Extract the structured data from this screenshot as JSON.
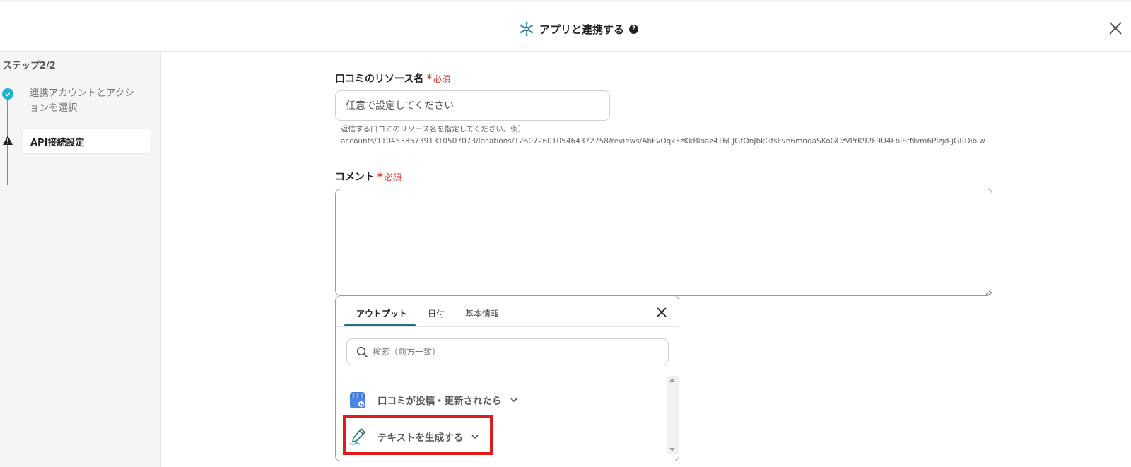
{
  "header": {
    "title": "アプリと連携する",
    "help_icon_glyph": "?",
    "app_icon": "network-hub-icon",
    "close_icon": "close-icon"
  },
  "sidebar": {
    "step_label": "ステップ2/2",
    "steps": [
      {
        "label": "連携アカウントとアクションを選択",
        "status": "completed"
      },
      {
        "label": "API接続設定",
        "status": "warning"
      }
    ],
    "accent_color": "#1bb4c8"
  },
  "form": {
    "resource_field": {
      "label": "口コミのリソース名",
      "required_mark": "*",
      "required_text": "必須",
      "placeholder": "任意で設定してください",
      "value": "",
      "hint_line1": "返信する口コミのリソース名を指定してください。例）",
      "hint_line2": "accounts/110453857391310507073/locations/12607260105464372758/reviews/AbFvOqk3zKkBloaz4T6CJGtOnJbkGfsFvn6mndaSKoGCzVPrK92F9U4FbIStNvm6Plzjd-jGRDiblw"
    },
    "comment_field": {
      "label": "コメント",
      "required_mark": "*",
      "required_text": "必須",
      "value": ""
    },
    "required_color": "#e0312b"
  },
  "output_popup": {
    "tabs": [
      {
        "label": "アウトプット",
        "active": true
      },
      {
        "label": "日付",
        "active": false
      },
      {
        "label": "基本情報",
        "active": false
      }
    ],
    "search_placeholder": "検索（前方一致）",
    "items": [
      {
        "label": "口コミが投稿・更新されたら",
        "icon": "google-business-icon"
      },
      {
        "label": "テキストを生成する",
        "icon": "pen-icon",
        "highlighted": true
      }
    ],
    "highlight_color": "#e01b1b",
    "tab_accent_color": "#1d6f86"
  }
}
